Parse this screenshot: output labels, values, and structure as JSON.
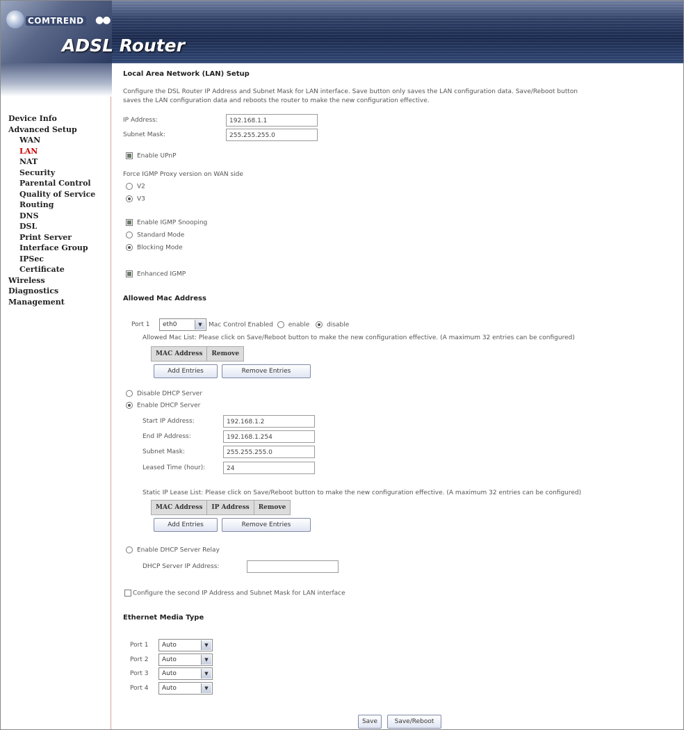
{
  "brand": {
    "logo_text": "COMTREND",
    "logo_dots": "●●",
    "product_title": "ADSL Router"
  },
  "nav": [
    {
      "label": "Device Info",
      "level": 0
    },
    {
      "label": "Advanced Setup",
      "level": 0
    },
    {
      "label": "WAN",
      "level": 1
    },
    {
      "label": "LAN",
      "level": 1,
      "active": true
    },
    {
      "label": "NAT",
      "level": 1
    },
    {
      "label": "Security",
      "level": 1
    },
    {
      "label": "Parental Control",
      "level": 1
    },
    {
      "label": "Quality of Service",
      "level": 1
    },
    {
      "label": "Routing",
      "level": 1
    },
    {
      "label": "DNS",
      "level": 1
    },
    {
      "label": "DSL",
      "level": 1
    },
    {
      "label": "Print Server",
      "level": 1
    },
    {
      "label": "Interface Group",
      "level": 1
    },
    {
      "label": "IPSec",
      "level": 1
    },
    {
      "label": "Certificate",
      "level": 1
    },
    {
      "label": "Wireless",
      "level": 0
    },
    {
      "label": "Diagnostics",
      "level": 0
    },
    {
      "label": "Management",
      "level": 0
    }
  ],
  "page": {
    "title": "Local Area Network (LAN) Setup",
    "desc_line1": "Configure the DSL Router IP Address and Subnet Mask for LAN interface.  Save button only saves the LAN configuration data.  Save/Reboot button",
    "desc_line2": "saves the LAN configuration data and reboots the router to make the new configuration effective."
  },
  "lan": {
    "ip_label": "IP Address:",
    "ip_value": "192.168.1.1",
    "mask_label": "Subnet Mask:",
    "mask_value": "255.255.255.0",
    "upnp_label": "Enable UPnP",
    "igmp_proxy_label": "Force IGMP Proxy version on WAN side",
    "v2_label": "V2",
    "v3_label": "V3",
    "snooping_label": "Enable IGMP Snooping",
    "standard_mode_label": "Standard Mode",
    "blocking_mode_label": "Blocking Mode",
    "enhanced_igmp_label": "Enhanced IGMP"
  },
  "mac": {
    "heading": "Allowed Mac Address",
    "port_label": "Port 1",
    "port_select": "eth0",
    "control_label": "Mac Control Enabled",
    "enable_label": "enable",
    "disable_label": "disable",
    "list_note": "Allowed Mac List: Please click on Save/Reboot button to make the new configuration effective. (A maximum 32 entries can be configured)",
    "col_mac": "MAC Address",
    "col_remove": "Remove",
    "add_btn": "Add Entries",
    "remove_btn": "Remove Entries"
  },
  "dhcp": {
    "disable_label": "Disable DHCP Server",
    "enable_label": "Enable DHCP Server",
    "start_label": "Start IP Address:",
    "start_value": "192.168.1.2",
    "end_label": "End IP Address:",
    "end_value": "192.168.1.254",
    "mask_label": "Subnet Mask:",
    "mask_value": "255.255.255.0",
    "lease_label": "Leased Time (hour):",
    "lease_value": "24",
    "static_note": "Static IP Lease List: Please click on Save/Reboot button to make the new configuration effective. (A maximum 32 entries can be configured)",
    "col_mac": "MAC Address",
    "col_ip": "IP Address",
    "col_remove": "Remove",
    "add_btn": "Add Entries",
    "remove_btn": "Remove Entries",
    "relay_label": "Enable DHCP Server Relay",
    "relay_ip_label": "DHCP Server IP Address:",
    "relay_ip_value": ""
  },
  "second_ip_label": "Configure the second IP Address and Subnet Mask for LAN interface",
  "ethernet": {
    "heading": "Ethernet Media Type",
    "ports": [
      {
        "label": "Port 1",
        "value": "Auto"
      },
      {
        "label": "Port 2",
        "value": "Auto"
      },
      {
        "label": "Port 3",
        "value": "Auto"
      },
      {
        "label": "Port 4",
        "value": "Auto"
      }
    ]
  },
  "actions": {
    "save": "Save",
    "save_reboot": "Save/Reboot"
  }
}
